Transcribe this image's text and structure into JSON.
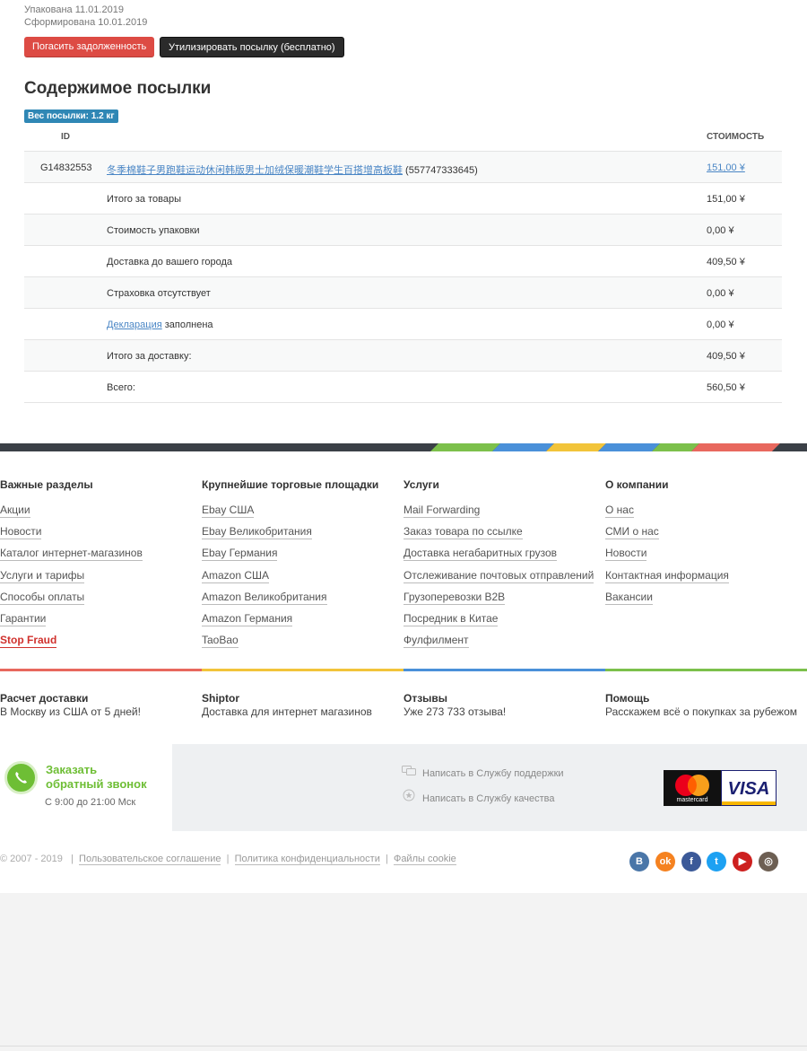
{
  "status": {
    "packed": "Упакована 11.01.2019",
    "formed": "Сформирована 10.01.2019"
  },
  "actions": {
    "pay_debt": "Погасить задолженность",
    "dispose": "Утилизировать посылку (бесплатно)"
  },
  "contents": {
    "title": "Содержимое посылки",
    "weight_badge": "Вес посылки: 1.2 кг",
    "col_id": "ID",
    "col_cost": "СТОИМОСТЬ",
    "item": {
      "id": "G14832553",
      "name_link": "冬季棉鞋子男跑鞋运动休闲韩版男士加绒保暖潮鞋学生百搭增高板鞋",
      "name_suffix": " (557747333645)",
      "cost": "151,00 ¥"
    },
    "rows": [
      {
        "label": "Итого за товары",
        "cost": "151,00 ¥"
      },
      {
        "label": "Стоимость упаковки",
        "cost": "0,00 ¥"
      },
      {
        "label": "Доставка до вашего города",
        "cost": "409,50 ¥"
      },
      {
        "label": "Страховка отсутствует",
        "cost": "0,00 ¥"
      },
      {
        "label_link": "Декларация",
        "label": " заполнена",
        "cost": "0,00 ¥"
      },
      {
        "label": "Итого за доставку:",
        "cost": "409,50 ¥"
      },
      {
        "label": "Всего:",
        "cost": "560,50 ¥"
      }
    ]
  },
  "footer": {
    "columns": [
      {
        "title": "Важные разделы",
        "links": [
          "Акции",
          "Новости",
          "Каталог интернет-магазинов",
          "Услуги и тарифы",
          "Способы оплаты",
          "Гарантии",
          "Stop Fraud"
        ]
      },
      {
        "title": "Крупнейшие торговые площадки",
        "links": [
          "Ebay США",
          "Ebay Великобритания",
          "Ebay Германия",
          "Amazon США",
          "Amazon Великобритания",
          "Amazon Германия",
          "TaoBao"
        ]
      },
      {
        "title": "Услуги",
        "links": [
          "Mail Forwarding",
          "Заказ товара по ссылке",
          "Доставка негабаритных грузов",
          "Отслеживание почтовых отправлений",
          "Грузоперевозки B2B",
          "Посредник в Китае",
          "Фулфилмент"
        ]
      },
      {
        "title": "О компании",
        "links": [
          "О нас",
          "СМИ о нас",
          "Новости",
          "Контактная информация",
          "Вакансии"
        ]
      }
    ],
    "info": [
      {
        "title": "Расчет доставки",
        "text": "В Москву из США от 5 дней!"
      },
      {
        "title": "Shiptor",
        "text": "Доставка для интернет магазинов"
      },
      {
        "title": "Отзывы",
        "text": "Уже 273 733 отзыва!"
      },
      {
        "title": "Помощь",
        "text": "Расскажем всё о покупках за рубежом"
      }
    ],
    "callback": {
      "title_1": "Заказать",
      "title_2": "обратный звонок",
      "hours": "С 9:00 до 21:00 Мск"
    },
    "support": "Написать в Службу поддержки",
    "quality": "Написать в Службу качества",
    "payment": {
      "mastercard": "mastercard",
      "visa": "VISA"
    },
    "copyright": "© 2007 - 2019",
    "legal": [
      "Пользовательское соглашение",
      "Политика конфиденциальности",
      "Файлы cookie"
    ],
    "social": [
      {
        "name": "vk-icon",
        "glyph": "B",
        "color": "#4a76a8"
      },
      {
        "name": "odnoklassniki-icon",
        "glyph": "ok",
        "color": "#f58220"
      },
      {
        "name": "facebook-icon",
        "glyph": "f",
        "color": "#3b5998"
      },
      {
        "name": "twitter-icon",
        "glyph": "t",
        "color": "#1da1f2"
      },
      {
        "name": "youtube-icon",
        "glyph": "▶",
        "color": "#cd201f"
      },
      {
        "name": "instagram-icon",
        "glyph": "◎",
        "color": "#6d5f53"
      }
    ],
    "colors": {
      "red": "#e8685e",
      "yellow": "#f2c43a",
      "blue": "#4a90d9",
      "green": "#7cc04b"
    }
  }
}
